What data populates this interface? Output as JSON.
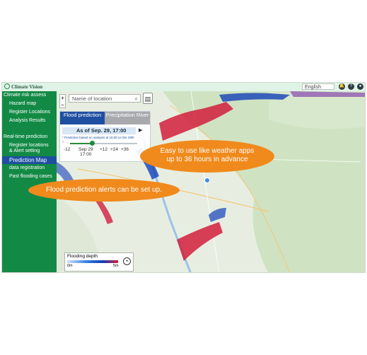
{
  "app": {
    "logo_text": "Climate Vision",
    "language": "English",
    "icons": [
      "notification-bell-icon",
      "help-icon",
      "user-icon"
    ]
  },
  "sidebar": {
    "section1": "Climate risk assess",
    "items1": [
      "Hazard map",
      "Register Locations",
      "Analysis Results"
    ],
    "section2": "Real-time prediction",
    "items2a": [
      "Register locations",
      "& Alert setting"
    ],
    "active": "Prediction Map",
    "items2b": [
      "data registration",
      "Past flooding cases"
    ]
  },
  "map": {
    "search_placeholder": "Name of location",
    "zoom_in": "+",
    "zoom_out": "−",
    "tabs": [
      "Flood prediction",
      "Precipitation River"
    ],
    "as_of": "As of Sep. 29, 17:00",
    "prediction_note": "* Prediction based on analysis at 15:00 on the 29th",
    "slider_ticks": [
      "-12",
      "Sep 29\n17:00",
      "+12",
      "+24",
      "+36"
    ],
    "slider_minus": "-",
    "slider_fraction": 0.33,
    "legend": {
      "title": "Flooding depth",
      "min": "0m",
      "max": "5m"
    }
  },
  "callouts": {
    "c1": "Easy to use like weather apps\nup to 36 hours in advance",
    "c2": "Flood prediction alerts can be set up."
  },
  "colors": {
    "sidebar": "#128a45",
    "active": "#1f4fa1",
    "callout": "#f08a1c",
    "flood_red": "#d21e3c",
    "flood_blue": "#1340b8"
  }
}
